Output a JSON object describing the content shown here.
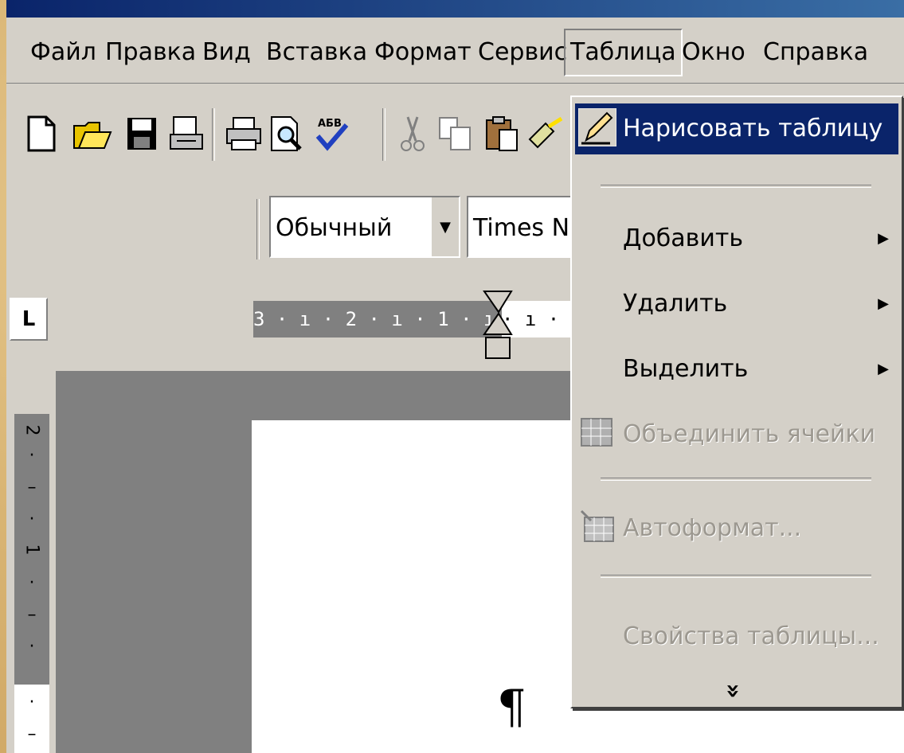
{
  "menu": {
    "items": [
      {
        "label": "Файл"
      },
      {
        "label": "Правка"
      },
      {
        "label": "Вид"
      },
      {
        "label": "Вставка"
      },
      {
        "label": "Формат"
      },
      {
        "label": "Сервис"
      },
      {
        "label": "Таблица"
      },
      {
        "label": "Окно"
      },
      {
        "label": "Справка"
      }
    ],
    "active": "Таблица"
  },
  "toolbar": {
    "icons": [
      "new-document-icon",
      "open-folder-icon",
      "save-icon",
      "email-icon",
      "print-icon",
      "print-preview-icon",
      "spelling-icon",
      "cut-icon",
      "copy-icon",
      "paste-icon",
      "format-painter-icon"
    ]
  },
  "formatting": {
    "style_value": "Обычный",
    "font_value": "Times Ne"
  },
  "ruler": {
    "tab_selector": "L",
    "left_text": "3 · ı · 2 · ı · 1 · ı ·",
    "right_text": "· ı ·",
    "vertical_labels": [
      "2",
      "1"
    ]
  },
  "document": {
    "pilcrow": "¶"
  },
  "table_menu": {
    "draw_table": "Нарисовать таблицу",
    "add": "Добавить",
    "delete": "Удалить",
    "select": "Выделить",
    "merge_cells": "Объединить ячейки",
    "autoformat": "Автоформат...",
    "properties": "Свойства таблицы...",
    "expand": "»"
  },
  "colors": {
    "highlight": "#0a246a",
    "face": "#d4d0c8",
    "disabled": "#9c9890"
  }
}
